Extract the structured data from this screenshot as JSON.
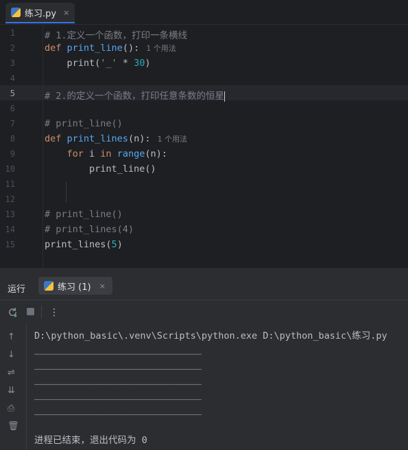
{
  "editor_tab": {
    "filename": "练习.py",
    "close": "×"
  },
  "code": {
    "line_numbers": [
      "1",
      "2",
      "3",
      "4",
      "5",
      "6",
      "7",
      "8",
      "9",
      "10",
      "11",
      "12",
      "13",
      "14",
      "15"
    ],
    "l1": "# 1.定义一个函数，打印一条横线",
    "l2_kw": "def",
    "l2_fn": "print_line",
    "l2_rest": "():",
    "l2_hint": "1 个用法",
    "l3_fn": "print",
    "l3_p1": "(",
    "l3_str": "'_'",
    "l3_op": " * ",
    "l3_num": "30",
    "l3_p2": ")",
    "l5": "# 2.的定义一个函数，打印任意条数的恒星",
    "l7": "# print_line()",
    "l8_kw": "def",
    "l8_fn": "print_lines",
    "l8_rest": "(n):",
    "l8_hint": "1 个用法",
    "l9_kw1": "for",
    "l9_var": " i ",
    "l9_kw2": "in",
    "l9_fn": "range",
    "l9_rest": "(n):",
    "l10": "print_line()",
    "l13": "# print_line()",
    "l14": "# print_lines(4)",
    "l15_fn": "print_lines",
    "l15_p1": "(",
    "l15_num": "5",
    "l15_p2": ")"
  },
  "run_panel": {
    "title": "运行",
    "tab_label": "练习 (1)",
    "tab_close": "×"
  },
  "console": {
    "command": "D:\\python_basic\\.venv\\Scripts\\python.exe D:\\python_basic\\练习.py",
    "output_lines": [
      "______________________________",
      "______________________________",
      "______________________________",
      "______________________________",
      "______________________________"
    ],
    "exit_message": "进程已结束，退出代码为 0"
  },
  "colors": {
    "accent": "#3574f0",
    "keyword": "#cf8e6d",
    "function": "#56a8f5",
    "string": "#6aab73",
    "number": "#2aacb8",
    "comment": "#7a7e85"
  }
}
